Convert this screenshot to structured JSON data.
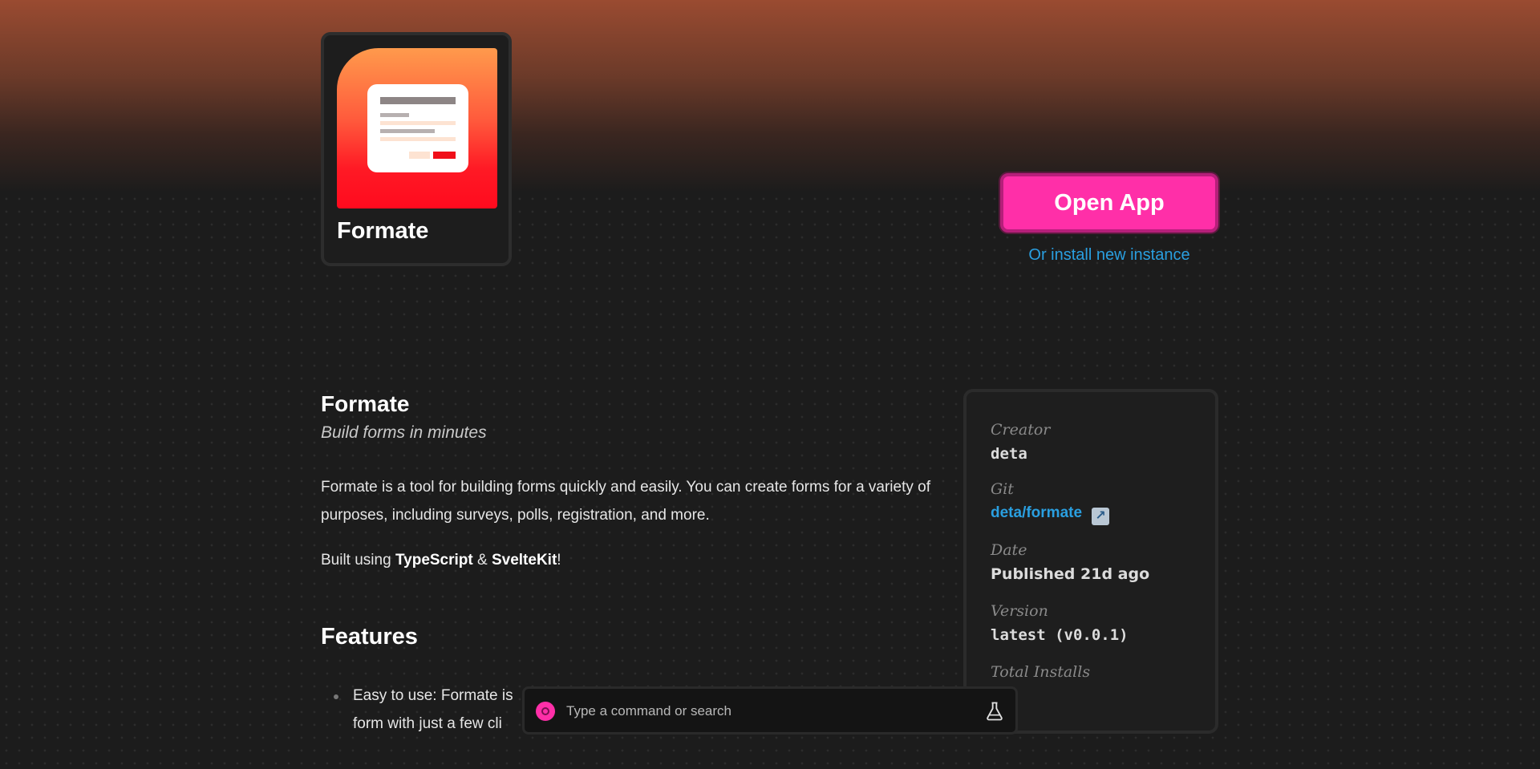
{
  "app": {
    "name": "Formate",
    "icon": "form-document-icon"
  },
  "actions": {
    "open_label": "Open App",
    "install_label": "Or install new instance"
  },
  "main": {
    "title": "Formate",
    "tagline": "Build forms in minutes",
    "description": "Formate is a tool for building forms quickly and easily. You can create forms for a variety of purposes, including surveys, polls, registration, and more.",
    "built_prefix": "Built using ",
    "built_tech_1": "TypeScript",
    "built_amp": " & ",
    "built_tech_2": "SvelteKit",
    "built_suffix": "!",
    "features_heading": "Features",
    "features": [
      "Easy to use: Formate is",
      "form with just a few cli"
    ]
  },
  "info": {
    "creator_label": "Creator",
    "creator_value": "deta",
    "git_label": "Git",
    "git_value": "deta/formate",
    "date_label": "Date",
    "date_prefix": "Published ",
    "date_value": "21d ago",
    "version_label": "Version",
    "version_value": "latest (v0.0.1)",
    "installs_label": "Total Installs"
  },
  "command_bar": {
    "placeholder": "Type a command or search"
  },
  "colors": {
    "accent_pink": "#ff2fa8",
    "link_blue": "#2a9fe0",
    "background": "#1c1c1c"
  }
}
